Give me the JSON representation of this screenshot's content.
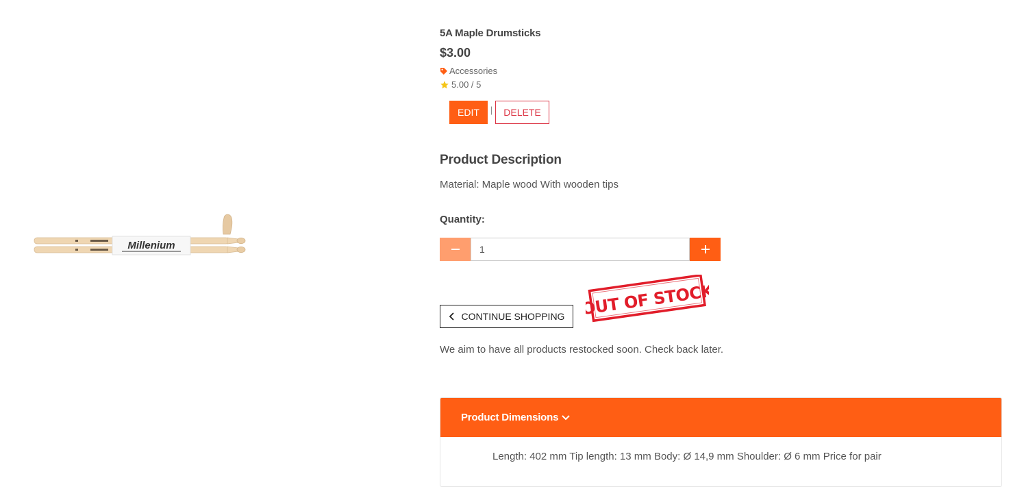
{
  "product": {
    "name": "5A Maple Drumsticks",
    "price": "$3.00",
    "category": "Accessories",
    "rating": "5.00 / 5",
    "image_brand": "Millenium"
  },
  "admin": {
    "edit_label": "EDIT",
    "separator": "|",
    "delete_label": "DELETE"
  },
  "description": {
    "heading": "Product Description",
    "text": "Material: Maple wood With wooden tips"
  },
  "quantity": {
    "label": "Quantity:",
    "value": "1"
  },
  "actions": {
    "continue_label": "CONTINUE SHOPPING"
  },
  "stock": {
    "stamp_text": "OUT OF STOCK",
    "note": "We aim to have all products restocked soon. Check back later."
  },
  "dimensions": {
    "title": "Product Dimensions",
    "text": "Length: 402 mm Tip length: 13 mm Body: Ø 14,9 mm Shoulder: Ø 6 mm Price for pair"
  },
  "colors": {
    "accent": "#ff5e14",
    "accent_light": "#ff9e6e",
    "danger": "#dc3545",
    "star": "#f5c518",
    "stamp": "#e11d2a"
  },
  "icons": {
    "category": "tag-icon",
    "rating": "star-icon",
    "decrement": "minus-icon",
    "increment": "plus-icon",
    "back": "chevron-left-icon",
    "expand": "chevron-down-icon"
  }
}
